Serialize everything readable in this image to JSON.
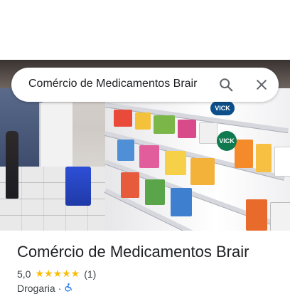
{
  "photo": {
    "alt_icon": "store-photo",
    "sign_text": "VICK"
  },
  "search": {
    "query": "Comércio de Medicamentos Brair",
    "search_icon": "search-icon",
    "close_icon": "close-icon"
  },
  "place": {
    "name": "Comércio de Medicamentos Brair",
    "rating": "5,0",
    "stars": "★★★★★",
    "review_count": "(1)",
    "category": "Drogaria",
    "separator": "·",
    "accessibility_icon": "wheelchair-icon"
  },
  "colors": {
    "star": "#fbbc04",
    "accessible": "#1a73e8",
    "text_primary": "#202124"
  }
}
